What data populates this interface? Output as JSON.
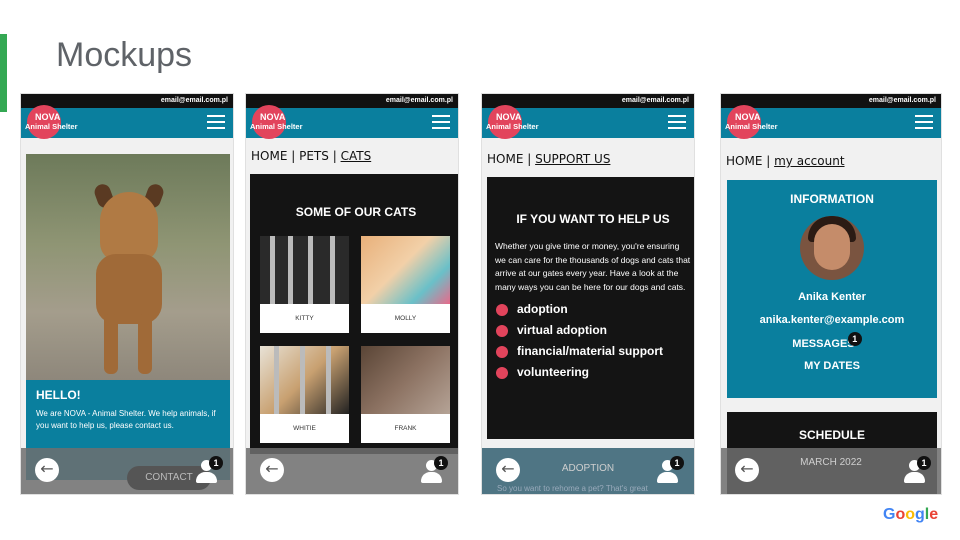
{
  "slide": {
    "title": "Mockups",
    "logo_text": "Google",
    "logo_colors": [
      "#4285f4",
      "#ea4335",
      "#fbbc05",
      "#4285f4",
      "#34a853",
      "#ea4335"
    ],
    "accent_color": "#34a853"
  },
  "common": {
    "email": "email@email.com.pl",
    "logo_line1": "NOVA",
    "logo_line2": "Animal Shelter",
    "back_arrow": "←",
    "badge_count": "1",
    "brand_teal": "#0a7f9e",
    "brand_red": "#e2445c"
  },
  "screen1": {
    "hello_title": "HELLO!",
    "hello_text": "We are NOVA - Animal Shelter. We help animals, if you want to help us, please contact us.",
    "contact_label": "CONTACT"
  },
  "screen2": {
    "crumb_home": "HOME",
    "crumb_pets": "PETS",
    "crumb_cats": "CATS",
    "separator": "|",
    "panel_title": "SOME OF OUR CATS",
    "cats": [
      "KITTY",
      "MOLLY",
      "WHITIE",
      "FRANK"
    ]
  },
  "screen3": {
    "crumb_home": "HOME",
    "crumb_support": "SUPPORT US",
    "separator": "|",
    "panel_title": "IF YOU WANT TO HELP US",
    "paragraph": "Whether you give time or money, you're ensuring we can care for the thousands of dogs and cats that arrive at our gates every year. Have a look at the many ways you can be here for our dogs and cats.",
    "items": [
      "adoption",
      "virtual adoption",
      "financial/material support",
      "volunteering"
    ],
    "bottom_label": "ADOPTION",
    "bottom_text": "So you want to rehome a pet? That's great"
  },
  "screen4": {
    "crumb_home": "HOME",
    "crumb_account": "my account",
    "separator": "|",
    "info_title": "INFORMATION",
    "name": "Anika Kenter",
    "email": "anika.kenter@example.com",
    "messages": "MESSAGES",
    "dates": "MY DATES",
    "schedule_title": "SCHEDULE",
    "schedule_month": "MARCH 2022"
  }
}
